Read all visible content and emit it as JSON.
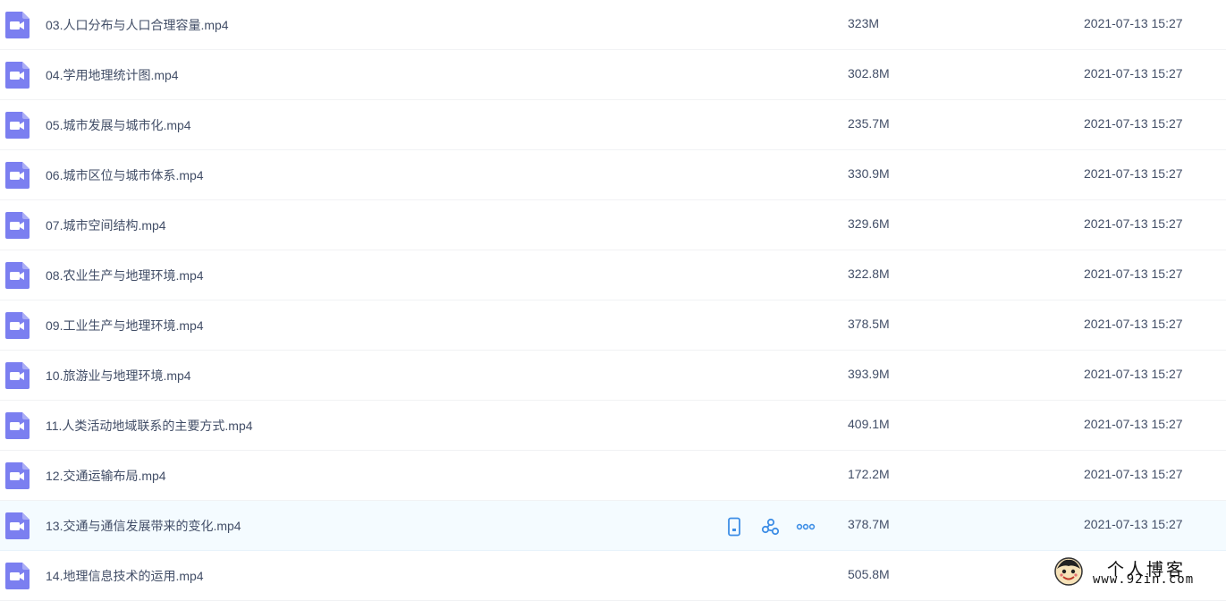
{
  "colors": {
    "file_icon": "#7b7ff0",
    "action_icon": "#3e8ee6",
    "hover_row": "#f4fbff",
    "text": "#424e67"
  },
  "file_icon_name": "video-file-icon",
  "files": [
    {
      "name": "03.人口分布与人口合理容量.mp4",
      "size": "323M",
      "date": "2021-07-13 15:27"
    },
    {
      "name": "04.学用地理统计图.mp4",
      "size": "302.8M",
      "date": "2021-07-13 15:27"
    },
    {
      "name": "05.城市发展与城市化.mp4",
      "size": "235.7M",
      "date": "2021-07-13 15:27"
    },
    {
      "name": "06.城市区位与城市体系.mp4",
      "size": "330.9M",
      "date": "2021-07-13 15:27"
    },
    {
      "name": "07.城市空间结构.mp4",
      "size": "329.6M",
      "date": "2021-07-13 15:27"
    },
    {
      "name": "08.农业生产与地理环境.mp4",
      "size": "322.8M",
      "date": "2021-07-13 15:27"
    },
    {
      "name": "09.工业生产与地理环境.mp4",
      "size": "378.5M",
      "date": "2021-07-13 15:27"
    },
    {
      "name": "10.旅游业与地理环境.mp4",
      "size": "393.9M",
      "date": "2021-07-13 15:27"
    },
    {
      "name": "11.人类活动地域联系的主要方式.mp4",
      "size": "409.1M",
      "date": "2021-07-13 15:27"
    },
    {
      "name": "12.交通运输布局.mp4",
      "size": "172.2M",
      "date": "2021-07-13 15:27"
    },
    {
      "name": "13.交通与通信发展带来的变化.mp4",
      "size": "378.7M",
      "date": "2021-07-13 15:27",
      "hovered": true
    },
    {
      "name": "14.地理信息技术的运用.mp4",
      "size": "505.8M",
      "date": ""
    }
  ],
  "row_actions": [
    {
      "icon": "phone-icon",
      "label": ""
    },
    {
      "icon": "share-icon",
      "label": ""
    },
    {
      "icon": "more-icon",
      "label": ""
    }
  ],
  "watermark": {
    "title": "个人博客",
    "url": "www.92in.com"
  }
}
